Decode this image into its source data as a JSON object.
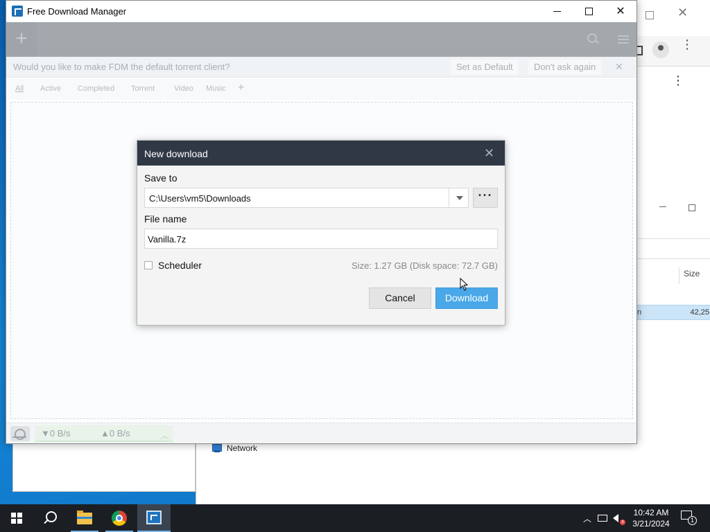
{
  "window": {
    "title": "Free Download Manager"
  },
  "notification": {
    "message": "Would you like to make FDM the default torrent client?",
    "set_default": "Set as Default",
    "dont_ask": "Don't ask again",
    "close": "✕"
  },
  "tabs": [
    "All",
    "Active",
    "Completed",
    "Torrent",
    "Video",
    "Music"
  ],
  "tab_add": "+",
  "status": {
    "down": "▼0 B/s",
    "up": "▲0 B/s",
    "toggle": "︿"
  },
  "dialog": {
    "title": "New download",
    "close": "✕",
    "save_to_label": "Save to",
    "save_to_value": "C:\\Users\\vm5\\Downloads",
    "browse": "···",
    "file_name_label": "File name",
    "file_name_value": "Vanilla.7z",
    "scheduler_label": "Scheduler",
    "scheduler_checked": false,
    "size_info": "Size: 1.27 GB (Disk space: 72.7 GB)",
    "cancel": "Cancel",
    "download": "Download"
  },
  "explorer": {
    "column_size": "Size",
    "row_name_fragment": "n",
    "row_size_fragment": "42,25",
    "network_label": "Network"
  },
  "taskbar": {
    "time": "10:42 AM",
    "date": "3/21/2024",
    "notification_count": "1",
    "tray_chevron": "︿"
  },
  "icons": {
    "app": "fdm-app-icon",
    "search": "search-icon",
    "menu": "hamburger-menu-icon",
    "snail": "snail-speed-icon"
  },
  "colors": {
    "dialog_header": "#303845",
    "download_button": "#4aa8e8",
    "desktop": "#1585d6",
    "taskbar": "#1b1f24"
  }
}
